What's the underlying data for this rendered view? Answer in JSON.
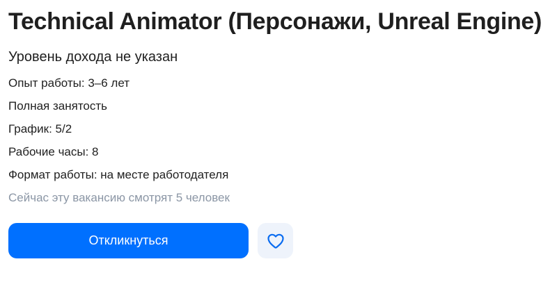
{
  "vacancy": {
    "title": "Technical Animator (Персонажи, Unreal Engine)",
    "salary": "Уровень дохода не указан",
    "details": {
      "experience": "Опыт работы: 3–6 лет",
      "employment": "Полная занятость",
      "schedule": "График: 5/2",
      "hours": "Рабочие часы: 8",
      "format": "Формат работы: на месте работодателя"
    },
    "viewers": "Сейчас эту вакансию смотрят 5 человек"
  },
  "actions": {
    "respond_label": "Откликнуться",
    "favorite_icon": "heart-icon"
  },
  "colors": {
    "primary_button": "#0070ff",
    "favorite_button_bg": "#eef3fb",
    "heart_stroke": "#0a6cf0",
    "muted_text": "#8b96a5"
  }
}
